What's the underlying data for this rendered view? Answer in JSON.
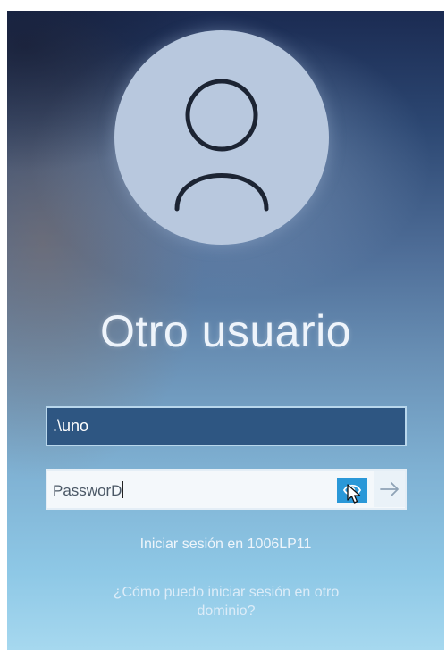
{
  "login": {
    "user_display_name": "Otro usuario",
    "username_value": ".\\uno",
    "password_value": "PassworD",
    "signin_target": "Iniciar sesión en 1006LP11",
    "other_domain_link": "¿Cómo puedo iniciar sesión en otro dominio?"
  },
  "icons": {
    "avatar": "user-icon",
    "reveal": "eye-icon",
    "submit": "arrow-right-icon",
    "pointer": "mouse-cursor-icon"
  },
  "colors": {
    "avatar_bg": "#b8c8de",
    "username_field_bg": "#2e5682",
    "reveal_button_bg": "#2a98d8"
  }
}
